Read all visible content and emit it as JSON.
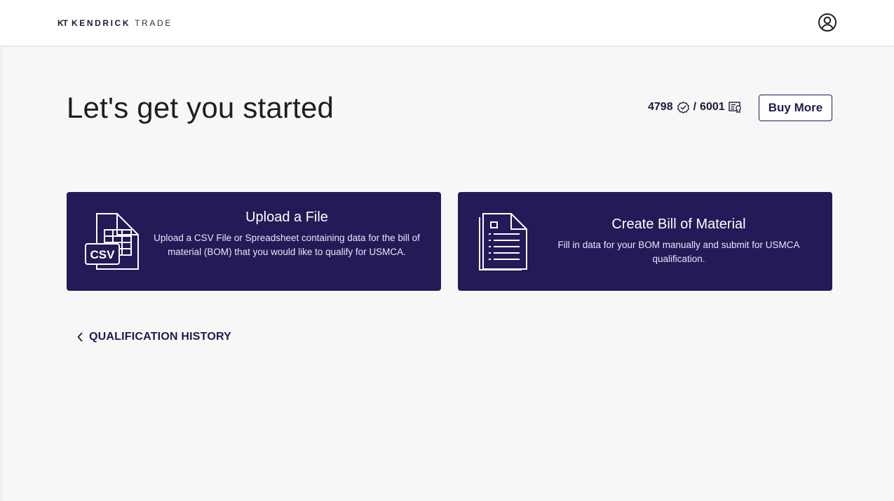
{
  "header": {
    "logo_mark": "KT",
    "logo_name": "KENDRICK",
    "logo_sub": "TRADE",
    "account_icon": "user-circle-icon"
  },
  "main": {
    "title": "Let's get you started",
    "credits": {
      "used": "4798",
      "used_icon": "verified-badge-icon",
      "separator": "/",
      "total": "6001",
      "total_icon": "certificate-icon"
    },
    "buy_more_label": "Buy More",
    "cards": [
      {
        "title": "Upload a File",
        "description": "Upload a CSV File or Spreadsheet containing data for the bill of material (BOM) that you would like to qualify for USMCA.",
        "icon": "csv-file-icon",
        "icon_label": "CSV"
      },
      {
        "title": "Create Bill of Material",
        "description": "Fill in data for your BOM manually and submit for USMCA qualification.",
        "icon": "document-list-icon"
      }
    ],
    "history_label": "QUALIFICATION HISTORY",
    "history_icon": "chevron-left-icon"
  },
  "colors": {
    "card_bg": "#231a57",
    "brand_text": "#23194f",
    "page_bg": "#f7f7f7"
  }
}
